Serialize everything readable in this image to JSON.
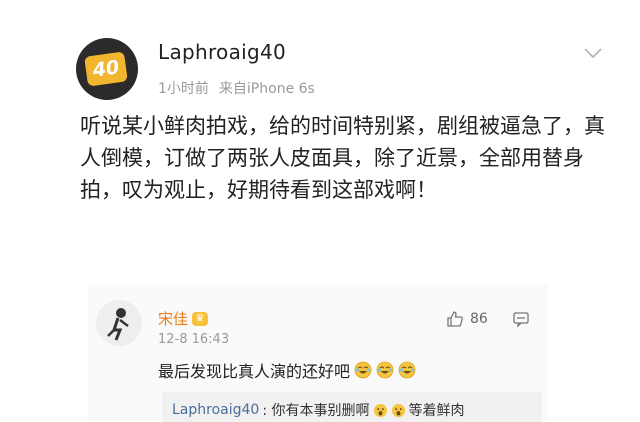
{
  "post": {
    "avatar_badge": "40",
    "username": "Laphroaig40",
    "time": "1小时前",
    "source": "来自iPhone 6s",
    "text": "听说某小鲜肉拍戏，给的时间特别紧，剧组被逼急了，真人倒模，订做了两张人皮面具，除了近景，全部用替身拍，叹为观止，好期待看到这部戏啊！",
    "menu_icon": "chevron-down-icon"
  },
  "comment": {
    "name": "宋佳",
    "badge_icon": "vip-crown-icon",
    "time": "12-8 16:43",
    "likes": "86",
    "text": "最后发现比真人演的还好吧",
    "emoji_icons": [
      "laugh-cry-icon",
      "laugh-cry-icon",
      "laugh-cry-icon"
    ],
    "reply": {
      "author": "Laphroaig40",
      "text_before": ": 你有本事别删啊",
      "text_after": "等着鲜肉"
    }
  },
  "colors": {
    "username_orange": "#e87f1c",
    "reply_blue": "#4a6f99",
    "badge_yellow": "#f2b530"
  }
}
